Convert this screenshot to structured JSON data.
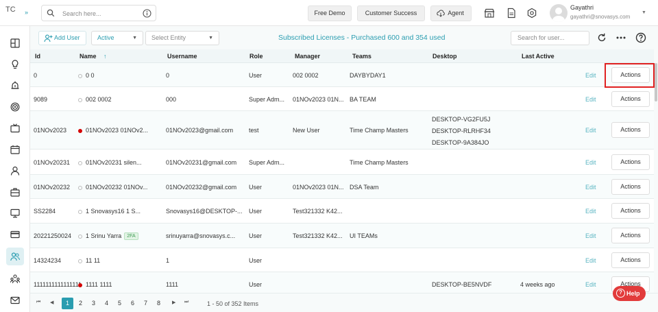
{
  "app": {
    "logo_alt": "TC",
    "logo_chevron": "»"
  },
  "search": {
    "placeholder": "Search here..."
  },
  "top_buttons": {
    "free_demo": "Free Demo",
    "customer_success": "Customer Success",
    "agent": "Agent"
  },
  "user": {
    "name": "Gayathri",
    "email": "gayathri@snovasys.com"
  },
  "toolbar": {
    "add_user": "Add User",
    "status_select": "Active",
    "entity_select": "Select Entity",
    "license_text": "Subscribed Licenses - Purchased 600 and 354 used",
    "user_search_placeholder": "Search for user..."
  },
  "table": {
    "columns": {
      "id": "Id",
      "name": "Name",
      "sort_indicator": "↑",
      "username": "Username",
      "role": "Role",
      "manager": "Manager",
      "teams": "Teams",
      "desktop": "Desktop",
      "last_active": "Last Active"
    },
    "rows": [
      {
        "id": "0",
        "name": "0 0",
        "status": "grey",
        "username": "0",
        "role": "User",
        "manager": "002 0002",
        "teams": "DAYBYDAY1",
        "desktop": [
          "",
          "",
          ""
        ],
        "last_active": "",
        "twofa": "",
        "edit": "Edit",
        "actions": "Actions"
      },
      {
        "id": "9089",
        "name": "002 0002",
        "status": "grey",
        "username": "000",
        "role": "Super Adm...",
        "manager": "01NOv2023 01N...",
        "teams": "BA TEAM",
        "desktop": [
          "",
          "",
          ""
        ],
        "last_active": "",
        "twofa": "",
        "edit": "Edit",
        "actions": "Actions"
      },
      {
        "id": "01NOv2023",
        "name": "01NOv2023 01NOv2...",
        "status": "red",
        "username": "01NOv2023@gmail.com",
        "role": "test",
        "manager": "New User",
        "teams": "Time Champ Masters",
        "desktop": [
          "DESKTOP-VG2FU5J",
          "DESKTOP-RLRHF34",
          "DESKTOP-9A384JO"
        ],
        "last_active": "",
        "twofa": "",
        "edit": "Edit",
        "actions": "Actions"
      },
      {
        "id": "01NOv20231",
        "name": "01NOv20231 silen...",
        "status": "grey",
        "username": "01NOv20231@gmail.com",
        "role": "Super Adm...",
        "manager": "",
        "teams": "Time Champ Masters",
        "desktop": [
          "",
          "",
          ""
        ],
        "last_active": "",
        "twofa": "",
        "edit": "Edit",
        "actions": "Actions"
      },
      {
        "id": "01NOv20232",
        "name": "01NOv20232 01NOv...",
        "status": "grey",
        "username": "01NOv20232@gmail.com",
        "role": "User",
        "manager": "01NOv2023 01N...",
        "teams": "DSA Team",
        "desktop": [
          "",
          "",
          ""
        ],
        "last_active": "",
        "twofa": "",
        "edit": "Edit",
        "actions": "Actions"
      },
      {
        "id": "SS2284",
        "name": "1 Snovasys16 1 S...",
        "status": "grey",
        "username": "Snovasys16@DESKTOP-...",
        "role": "User",
        "manager": "Test321332 K42...",
        "teams": "",
        "desktop": [
          "",
          "",
          ""
        ],
        "last_active": "",
        "twofa": "",
        "edit": "Edit",
        "actions": "Actions"
      },
      {
        "id": "20221250024",
        "name": "1 Srinu Yarra",
        "status": "grey",
        "username": "srinuyarra@snovasys.c...",
        "role": "User",
        "manager": "Test321332 K42...",
        "teams": "UI TEAMs",
        "desktop": [
          "",
          "",
          ""
        ],
        "last_active": "",
        "twofa": "2FA",
        "edit": "Edit",
        "actions": "Actions"
      },
      {
        "id": "14324234",
        "name": "11 11",
        "status": "grey",
        "username": "1",
        "role": "User",
        "manager": "",
        "teams": "",
        "desktop": [
          "",
          "",
          ""
        ],
        "last_active": "",
        "twofa": "",
        "edit": "Edit",
        "actions": "Actions"
      },
      {
        "id": "1111111111111111",
        "name": "1111 1111",
        "status": "red",
        "username": "1111",
        "role": "User",
        "manager": "",
        "teams": "",
        "desktop": [
          "DESKTOP-BE5NVDF",
          "",
          ""
        ],
        "last_active": "4 weeks ago",
        "twofa": "",
        "edit": "Edit",
        "actions": "Actions"
      }
    ]
  },
  "pagination": {
    "pages": [
      "1",
      "2",
      "3",
      "4",
      "5",
      "6",
      "7",
      "8"
    ],
    "current": "1",
    "first": "⏮",
    "prev": "◀",
    "next": "▶",
    "last": "⏭",
    "info": "1 - 50 of 352 Items"
  },
  "help": {
    "label": "Help"
  },
  "colors": {
    "accent": "#2a9db0",
    "status_red": "#d40000",
    "help_red": "#e23b3b",
    "highlight": "#e02020"
  },
  "icons": {
    "sidebar": [
      "dashboard-icon",
      "lightbulb-icon",
      "alarm-icon",
      "target-icon",
      "tv-icon",
      "calendar-icon",
      "person-icon",
      "briefcase-icon",
      "monitor-icon",
      "card-icon",
      "users-icon",
      "org-icon",
      "mail-icon"
    ],
    "top": [
      "store-icon",
      "document-icon",
      "settings-icon"
    ]
  }
}
